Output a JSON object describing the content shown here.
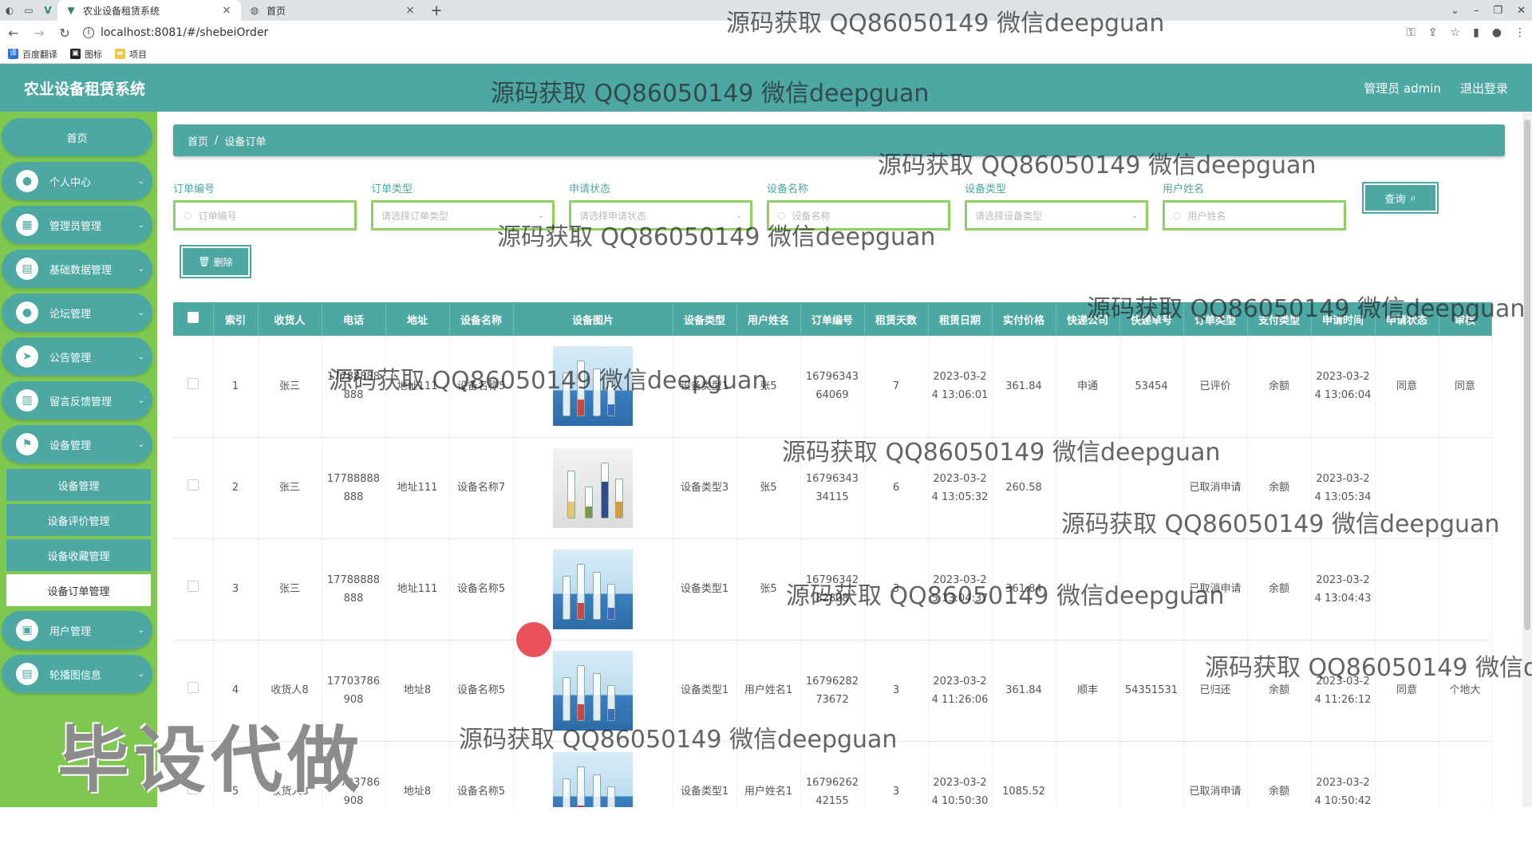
{
  "browser": {
    "tabs": [
      {
        "title": "农业设备租赁系统",
        "active": true
      },
      {
        "title": "首页",
        "active": false
      }
    ],
    "url": "localhost:8081/#/shebeiOrder",
    "bookmarks": [
      "百度翻译",
      "图标",
      "项目"
    ]
  },
  "header": {
    "title": "农业设备租赁系统",
    "user": "管理员 admin",
    "logout": "退出登录"
  },
  "sidebar": {
    "home": "首页",
    "items": [
      {
        "label": "个人中心",
        "icon": "user-icon"
      },
      {
        "label": "管理员管理",
        "icon": "grid-icon"
      },
      {
        "label": "基础数据管理",
        "icon": "chart-icon"
      },
      {
        "label": "论坛管理",
        "icon": "user-icon"
      },
      {
        "label": "公告管理",
        "icon": "send-icon"
      },
      {
        "label": "留言反馈管理",
        "icon": "bars-icon"
      },
      {
        "label": "设备管理",
        "icon": "flag-icon"
      }
    ],
    "submenu": [
      "设备管理",
      "设备评价管理",
      "设备收藏管理",
      "设备订单管理"
    ],
    "items_after": [
      {
        "label": "用户管理",
        "icon": "users-icon"
      },
      {
        "label": "轮播图信息",
        "icon": "doc-icon"
      }
    ]
  },
  "breadcrumb": {
    "home": "首页",
    "current": "设备订单"
  },
  "filters": [
    {
      "label": "订单编号",
      "placeholder": "订单编号",
      "type": "input"
    },
    {
      "label": "订单类型",
      "placeholder": "请选择订单类型",
      "type": "select"
    },
    {
      "label": "申请状态",
      "placeholder": "请选择申请状态",
      "type": "select"
    },
    {
      "label": "设备名称",
      "placeholder": "设备名称",
      "type": "input"
    },
    {
      "label": "设备类型",
      "placeholder": "请选择设备类型",
      "type": "select"
    },
    {
      "label": "用户姓名",
      "placeholder": "用户姓名",
      "type": "input"
    }
  ],
  "search_label": "查询",
  "delete_label": "删除",
  "table": {
    "columns": [
      "索引",
      "收货人",
      "电话",
      "地址",
      "设备名称",
      "设备图片",
      "设备类型",
      "用户姓名",
      "订单编号",
      "租赁天数",
      "租赁日期",
      "实付价格",
      "快递公司",
      "快递单号",
      "订单类型",
      "支付类型",
      "申请时间",
      "申请状态",
      "审核"
    ],
    "rows": [
      {
        "idx": "1",
        "receiver": "张三",
        "phone": "17788888888",
        "addr": "地址111",
        "name": "设备名称5",
        "img": "blue",
        "type": "设备类型1",
        "user": "张5",
        "order": "1679634364069",
        "days": "7",
        "date": "2023-03-24 13:06:01",
        "price": "361.84",
        "express": "申通",
        "expno": "53454",
        "otype": "已评价",
        "pay": "余额",
        "atime": "2023-03-24 13:06:04",
        "astatus": "同意",
        "audit": "同意"
      },
      {
        "idx": "2",
        "receiver": "张三",
        "phone": "17788888888",
        "addr": "地址111",
        "name": "设备名称7",
        "img": "gray",
        "type": "设备类型3",
        "user": "张5",
        "order": "1679634334115",
        "days": "6",
        "date": "2023-03-24 13:05:32",
        "price": "260.58",
        "express": "",
        "expno": "",
        "otype": "已取消申请",
        "pay": "余额",
        "atime": "2023-03-24 13:05:34",
        "astatus": "",
        "audit": ""
      },
      {
        "idx": "3",
        "receiver": "张三",
        "phone": "17788888888",
        "addr": "地址111",
        "name": "设备名称5",
        "img": "blue",
        "type": "设备类型1",
        "user": "张5",
        "order": "1679634282808",
        "days": "3",
        "date": "2023-03-25 13:04:37",
        "price": "361.84",
        "express": "",
        "expno": "",
        "otype": "已取消申请",
        "pay": "余额",
        "atime": "2023-03-24 13:04:43",
        "astatus": "",
        "audit": ""
      },
      {
        "idx": "4",
        "receiver": "收货人8",
        "phone": "17703786908",
        "addr": "地址8",
        "name": "设备名称5",
        "img": "blue",
        "type": "设备类型1",
        "user": "用户姓名1",
        "order": "1679628273672",
        "days": "3",
        "date": "2023-03-24 11:26:06",
        "price": "361.84",
        "express": "顺丰",
        "expno": "54351531",
        "otype": "已归还",
        "pay": "余额",
        "atime": "2023-03-24 11:26:12",
        "astatus": "同意",
        "audit": "个地大"
      },
      {
        "idx": "5",
        "receiver": "收货人8",
        "phone": "17703786908",
        "addr": "地址8",
        "name": "设备名称5",
        "img": "blue",
        "type": "设备类型1",
        "user": "用户姓名1",
        "order": "1679626242155",
        "days": "3",
        "date": "2023-03-24 10:50:30",
        "price": "1085.52",
        "express": "",
        "expno": "",
        "otype": "已取消申请",
        "pay": "余额",
        "atime": "2023-03-24 10:50:42",
        "astatus": "",
        "audit": ""
      }
    ]
  },
  "watermark_text": "源码获取 QQ86050149 微信deepguan",
  "big_watermark": "毕设代做",
  "colors": {
    "primary": "#4da7a3",
    "sidebar": "#7ec850",
    "input_border": "#8fd065"
  }
}
